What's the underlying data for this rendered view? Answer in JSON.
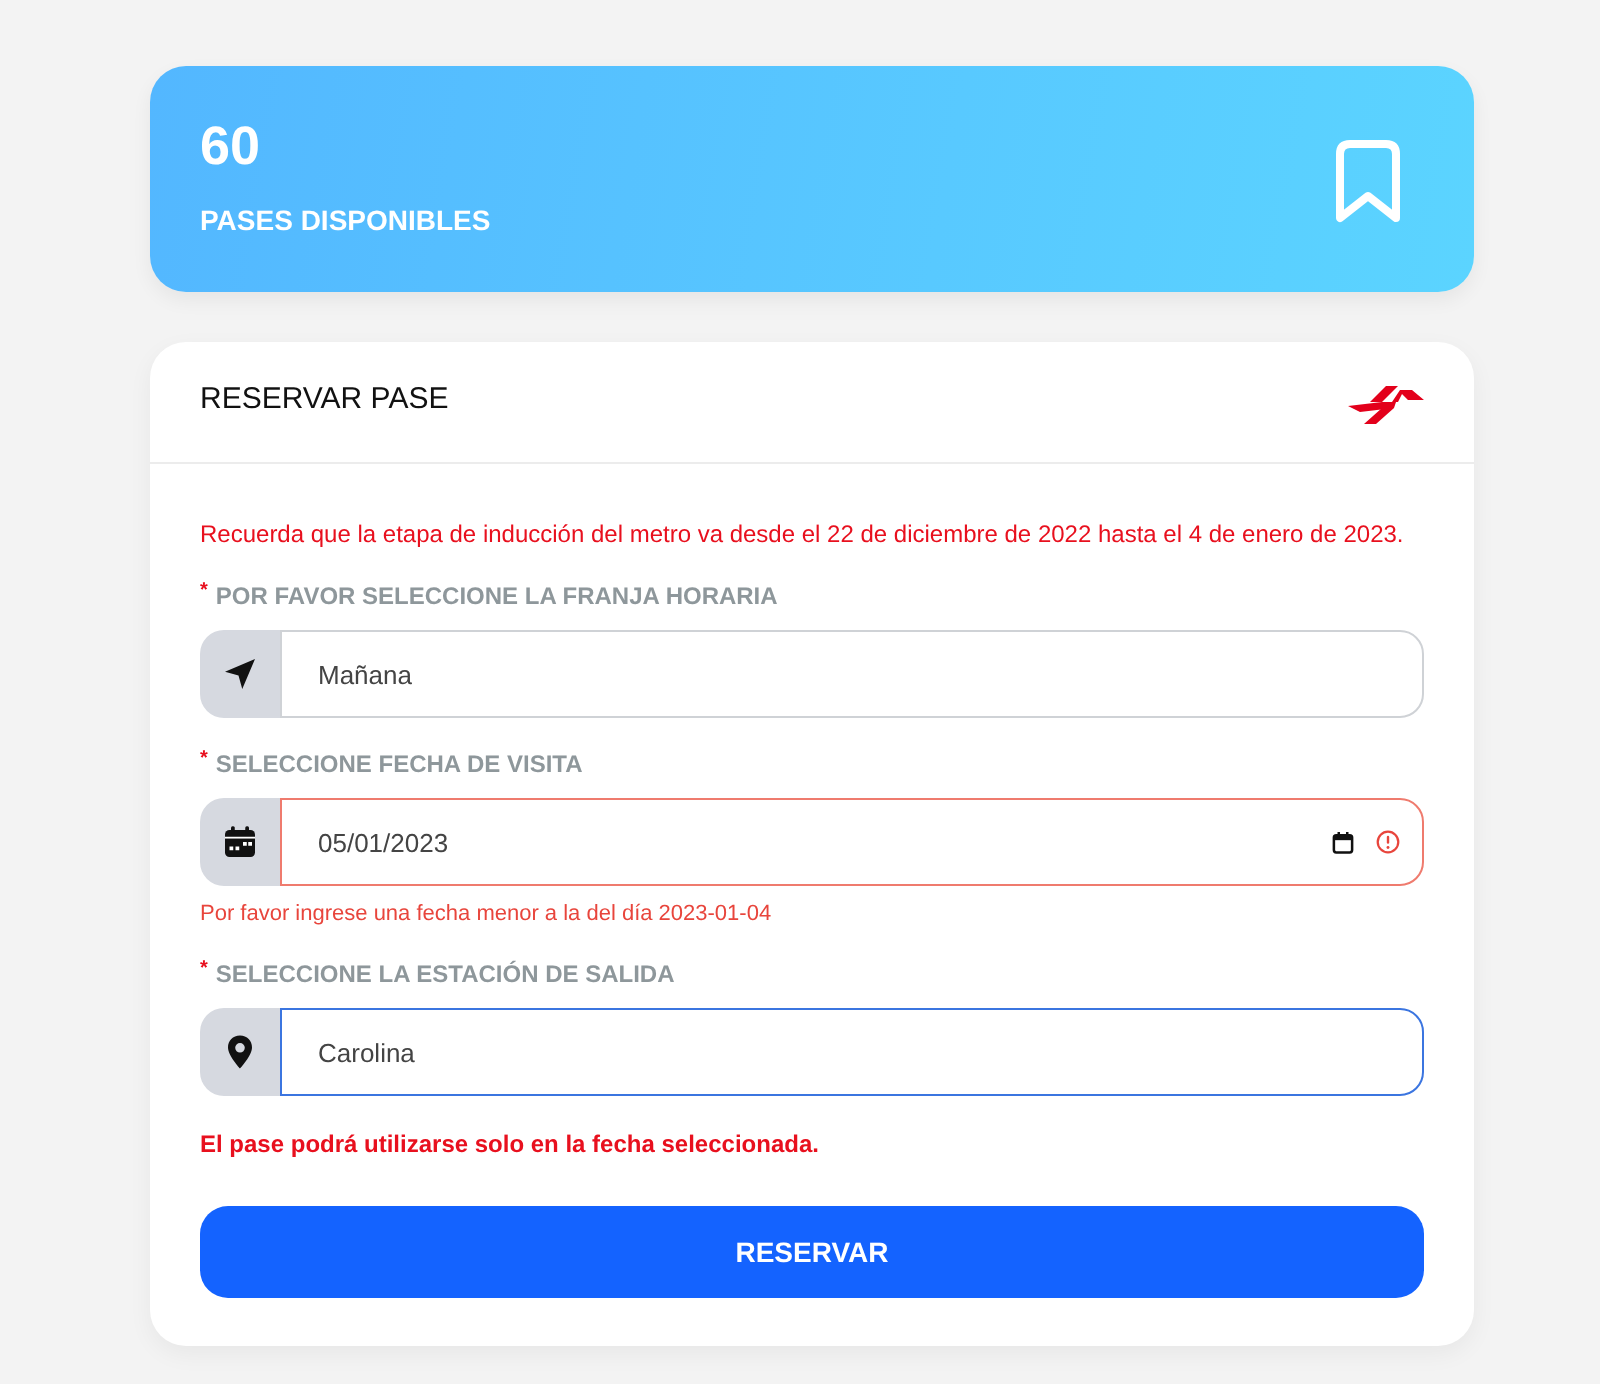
{
  "summary": {
    "count": "60",
    "label": "PASES DISPONIBLES"
  },
  "form": {
    "title": "RESERVAR PASE",
    "notice": "Recuerda que la etapa de inducción del metro va desde el 22 de diciembre de 2022 hasta el 4 de enero de 2023.",
    "fields": [
      {
        "kind": "timeslot",
        "required_mark": "*",
        "label": "POR FAVOR SELECCIONE LA FRANJA HORARIA",
        "value": "Mañana",
        "invalid": false,
        "focused": false
      },
      {
        "kind": "date",
        "required_mark": "*",
        "label": "SELECCIONE FECHA DE VISITA",
        "value": "05/01/2023",
        "invalid": true,
        "focused": false,
        "error": "Por favor ingrese una fecha menor a la del día 2023-01-04"
      },
      {
        "kind": "station",
        "required_mark": "*",
        "label": "SELECCIONE LA ESTACIÓN DE SALIDA",
        "value": "Carolina",
        "invalid": false,
        "focused": true
      }
    ],
    "note": "El pase podrá utilizarse solo en la fecha seleccionada.",
    "submit": "RESERVAR"
  }
}
